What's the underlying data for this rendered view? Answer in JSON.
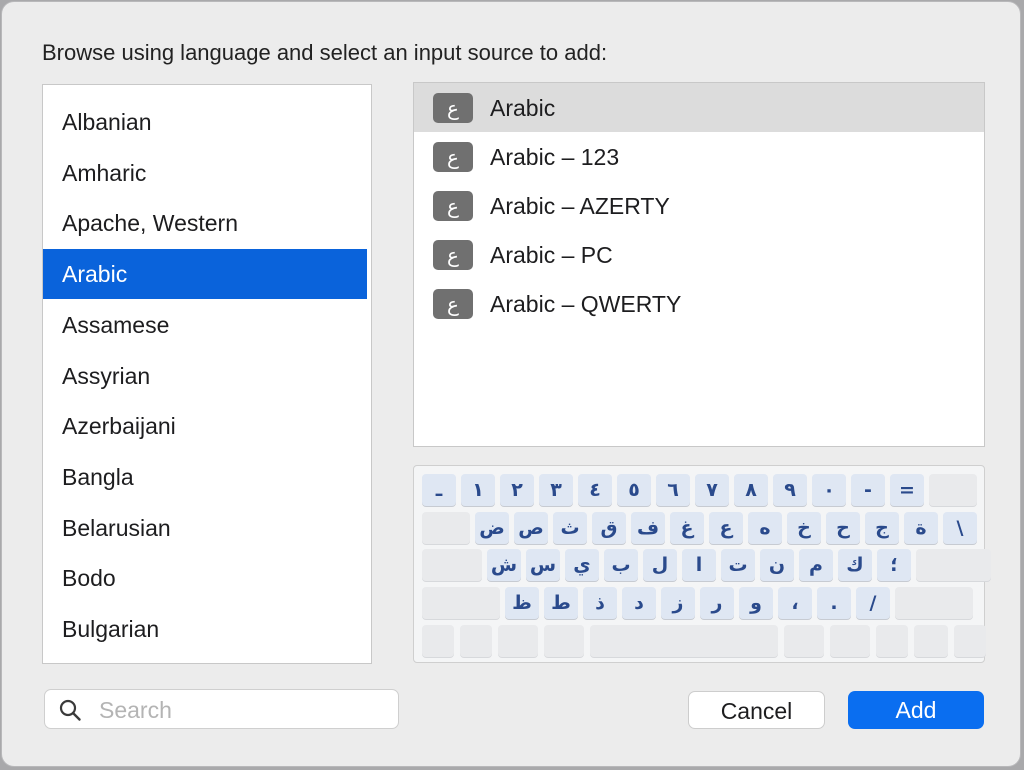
{
  "dialog": {
    "prompt": "Browse using language and select an input source to add:"
  },
  "languages": {
    "items": [
      {
        "label": "Albanian",
        "selected": false
      },
      {
        "label": "Amharic",
        "selected": false
      },
      {
        "label": "Apache, Western",
        "selected": false
      },
      {
        "label": "Arabic",
        "selected": true
      },
      {
        "label": "Assamese",
        "selected": false
      },
      {
        "label": "Assyrian",
        "selected": false
      },
      {
        "label": "Azerbaijani",
        "selected": false
      },
      {
        "label": "Bangla",
        "selected": false
      },
      {
        "label": "Belarusian",
        "selected": false
      },
      {
        "label": "Bodo",
        "selected": false
      },
      {
        "label": "Bulgarian",
        "selected": false
      }
    ]
  },
  "sources": {
    "badge_glyph": "ع",
    "items": [
      {
        "label": "Arabic",
        "selected": true
      },
      {
        "label": "Arabic – 123",
        "selected": false
      },
      {
        "label": "Arabic – AZERTY",
        "selected": false
      },
      {
        "label": "Arabic – PC",
        "selected": false
      },
      {
        "label": "Arabic – QWERTY",
        "selected": false
      }
    ]
  },
  "keyboard": {
    "rows": [
      [
        "ـ",
        "١",
        "٢",
        "٣",
        "٤",
        "٥",
        "٦",
        "٧",
        "٨",
        "٩",
        "٠",
        "-",
        "=",
        ""
      ],
      [
        "",
        "ض",
        "ص",
        "ث",
        "ق",
        "ف",
        "غ",
        "ع",
        "ه",
        "خ",
        "ح",
        "ج",
        "ة",
        "\\"
      ],
      [
        "",
        "ش",
        "س",
        "ي",
        "ب",
        "ل",
        "ا",
        "ت",
        "ن",
        "م",
        "ك",
        "؛",
        ""
      ],
      [
        "",
        "ظ",
        "ط",
        "ذ",
        "د",
        "ز",
        "ر",
        "و",
        "،",
        ".",
        "/",
        ""
      ],
      [
        "",
        "",
        "",
        "",
        "",
        "",
        "",
        "",
        "",
        ""
      ]
    ]
  },
  "search": {
    "placeholder": "Search",
    "value": ""
  },
  "buttons": {
    "cancel": "Cancel",
    "add": "Add"
  },
  "colors": {
    "accent": "#0a63db",
    "add_button": "#0a6ef0",
    "key_face": "#dfe7f3",
    "key_text": "#2a4a8c"
  }
}
